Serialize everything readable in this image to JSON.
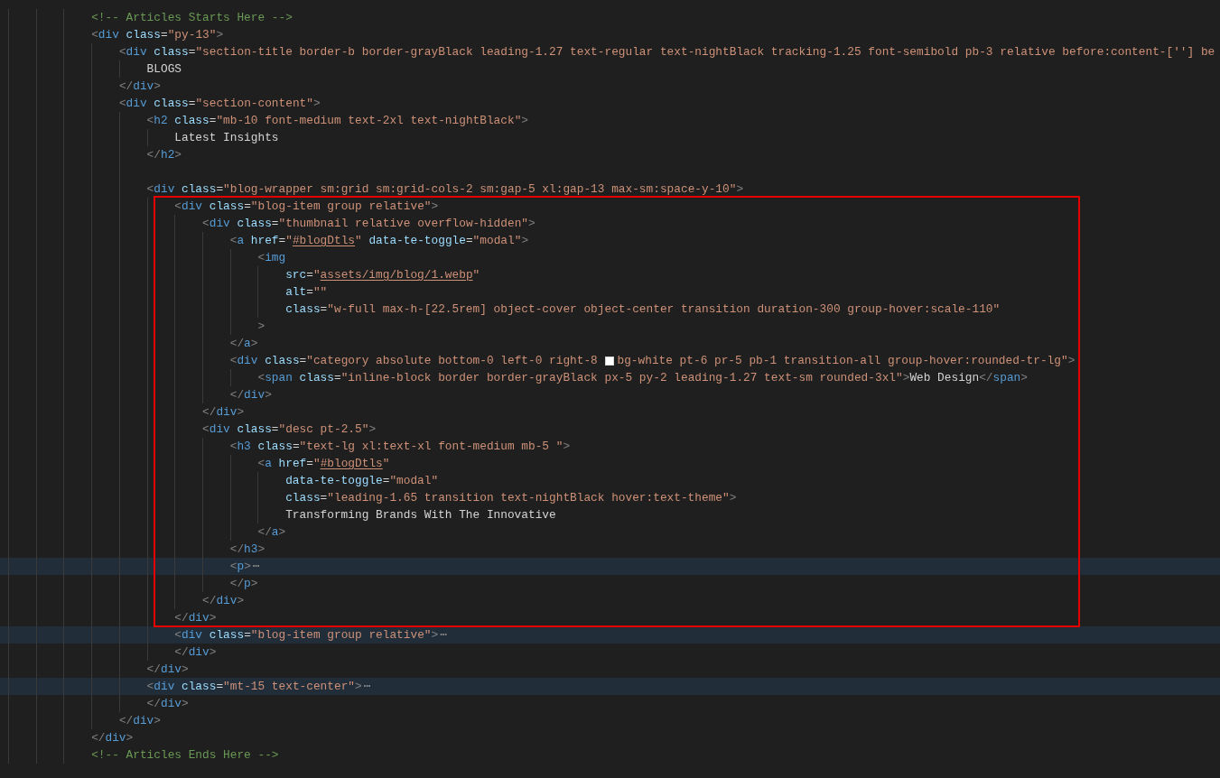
{
  "editor": {
    "lines": [
      {
        "highlighted": false,
        "parts": [
          {
            "kind": "code",
            "text": "            <!-- Articles Starts Here -->"
          }
        ]
      },
      {
        "highlighted": false,
        "parts": [
          {
            "kind": "code",
            "text": "            <div class=\"py-13\">"
          }
        ]
      },
      {
        "highlighted": false,
        "parts": [
          {
            "kind": "code",
            "text": "                <div class=\"section-title border-b border-grayBlack leading-1.27 text-regular text-nightBlack tracking-1.25 font-semibold pb-3 relative before:content-[''] be"
          }
        ]
      },
      {
        "highlighted": false,
        "parts": [
          {
            "kind": "code",
            "text": "                    BLOGS"
          }
        ]
      },
      {
        "highlighted": false,
        "parts": [
          {
            "kind": "code",
            "text": "                </div>"
          }
        ]
      },
      {
        "highlighted": false,
        "parts": [
          {
            "kind": "code",
            "text": "                <div class=\"section-content\">"
          }
        ]
      },
      {
        "highlighted": false,
        "parts": [
          {
            "kind": "code",
            "text": "                    <h2 class=\"mb-10 font-medium text-2xl text-nightBlack\">"
          }
        ]
      },
      {
        "highlighted": false,
        "parts": [
          {
            "kind": "code",
            "text": "                        Latest Insights"
          }
        ]
      },
      {
        "highlighted": false,
        "parts": [
          {
            "kind": "code",
            "text": "                    </h2>"
          }
        ]
      },
      {
        "highlighted": false
      },
      {
        "highlighted": false,
        "parts": [
          {
            "kind": "code",
            "text": "                    <div class=\"blog-wrapper sm:grid sm:grid-cols-2 sm:gap-5 xl:gap-13 max-sm:space-y-10\">"
          }
        ]
      },
      {
        "highlighted": false,
        "parts": [
          {
            "kind": "code",
            "text": "                        <div class=\"blog-item group relative\">"
          }
        ]
      },
      {
        "highlighted": false,
        "parts": [
          {
            "kind": "code",
            "text": "                            <div class=\"thumbnail relative overflow-hidden\">"
          }
        ]
      },
      {
        "highlighted": false,
        "parts": [
          {
            "kind": "code",
            "text": "                                <a href=\""
          },
          {
            "kind": "link",
            "text": "#blogDtls"
          },
          {
            "kind": "code",
            "text": "\" data-te-toggle=\"modal\">"
          }
        ]
      },
      {
        "highlighted": false,
        "parts": [
          {
            "kind": "code",
            "text": "                                    <img"
          }
        ]
      },
      {
        "highlighted": false,
        "parts": [
          {
            "kind": "code",
            "text": "                                        src=\""
          },
          {
            "kind": "link",
            "text": "assets/img/blog/1.webp"
          },
          {
            "kind": "code",
            "text": "\""
          }
        ]
      },
      {
        "highlighted": false,
        "parts": [
          {
            "kind": "code",
            "text": "                                        alt=\"\""
          }
        ]
      },
      {
        "highlighted": false,
        "parts": [
          {
            "kind": "code",
            "text": "                                        class=\"w-full max-h-[22.5rem] object-cover object-center transition duration-300 group-hover:scale-110\""
          }
        ]
      },
      {
        "highlighted": false,
        "parts": [
          {
            "kind": "code",
            "text": "                                    >"
          }
        ]
      },
      {
        "highlighted": false,
        "parts": [
          {
            "kind": "code",
            "text": "                                </a>"
          }
        ]
      },
      {
        "highlighted": false,
        "parts": [
          {
            "kind": "code",
            "text": "                                <div class=\"category absolute bottom-0 left-0 right-8 "
          },
          {
            "kind": "color-swatch",
            "color": "#ffffff"
          },
          {
            "kind": "code",
            "text": "bg-white pt-6 pr-5 pb-1 transition-all group-hover:rounded-tr-lg\">"
          }
        ]
      },
      {
        "highlighted": false,
        "parts": [
          {
            "kind": "code",
            "text": "                                    <span class=\"inline-block border border-grayBlack px-5 py-2 leading-1.27 text-sm rounded-3xl\">Web Design</span>"
          }
        ]
      },
      {
        "highlighted": false,
        "parts": [
          {
            "kind": "code",
            "text": "                                </div>"
          }
        ]
      },
      {
        "highlighted": false,
        "parts": [
          {
            "kind": "code",
            "text": "                            </div>"
          }
        ]
      },
      {
        "highlighted": false,
        "parts": [
          {
            "kind": "code",
            "text": "                            <div class=\"desc pt-2.5\">"
          }
        ]
      },
      {
        "highlighted": false,
        "parts": [
          {
            "kind": "code",
            "text": "                                <h3 class=\"text-lg xl:text-xl font-medium mb-5 \">"
          }
        ]
      },
      {
        "highlighted": false,
        "parts": [
          {
            "kind": "code",
            "text": "                                    <a href=\""
          },
          {
            "kind": "link",
            "text": "#blogDtls"
          },
          {
            "kind": "code",
            "text": "\""
          }
        ]
      },
      {
        "highlighted": false,
        "parts": [
          {
            "kind": "code",
            "text": "                                        data-te-toggle=\"modal\""
          }
        ]
      },
      {
        "highlighted": false,
        "parts": [
          {
            "kind": "code",
            "text": "                                        class=\"leading-1.65 transition text-nightBlack hover:text-theme\">"
          }
        ]
      },
      {
        "highlighted": false,
        "parts": [
          {
            "kind": "code",
            "text": "                                        Transforming Brands With The Innovative"
          }
        ]
      },
      {
        "highlighted": false,
        "parts": [
          {
            "kind": "code",
            "text": "                                    </a>"
          }
        ]
      },
      {
        "highlighted": false,
        "parts": [
          {
            "kind": "code",
            "text": "                                </h3>"
          }
        ]
      },
      {
        "highlighted": true,
        "parts": [
          {
            "kind": "code",
            "text": "                                <p>"
          },
          {
            "kind": "fold",
            "text": "⋯"
          }
        ]
      },
      {
        "highlighted": false,
        "parts": [
          {
            "kind": "code",
            "text": "                                </p>"
          }
        ]
      },
      {
        "highlighted": false,
        "parts": [
          {
            "kind": "code",
            "text": "                            </div>"
          }
        ]
      },
      {
        "highlighted": false,
        "parts": [
          {
            "kind": "code",
            "text": "                        </div>"
          }
        ]
      },
      {
        "highlighted": true,
        "parts": [
          {
            "kind": "code",
            "text": "                        <div class=\"blog-item group relative\">"
          },
          {
            "kind": "fold",
            "text": "⋯"
          }
        ]
      },
      {
        "highlighted": false,
        "parts": [
          {
            "kind": "code",
            "text": "                        </div>"
          }
        ]
      },
      {
        "highlighted": false,
        "parts": [
          {
            "kind": "code",
            "text": "                    </div>"
          }
        ]
      },
      {
        "highlighted": true,
        "parts": [
          {
            "kind": "code",
            "text": "                    <div class=\"mt-15 text-center\">"
          },
          {
            "kind": "fold",
            "text": "⋯"
          }
        ]
      },
      {
        "highlighted": false,
        "parts": [
          {
            "kind": "code",
            "text": "                    </div>"
          }
        ]
      },
      {
        "highlighted": false,
        "parts": [
          {
            "kind": "code",
            "text": "                </div>"
          }
        ]
      },
      {
        "highlighted": false,
        "parts": [
          {
            "kind": "code",
            "text": "            </div>"
          }
        ]
      },
      {
        "highlighted": false,
        "parts": [
          {
            "kind": "code",
            "text": "            <!-- Articles Ends Here -->"
          }
        ]
      }
    ]
  },
  "annotation": {
    "kind": "rectangle"
  }
}
